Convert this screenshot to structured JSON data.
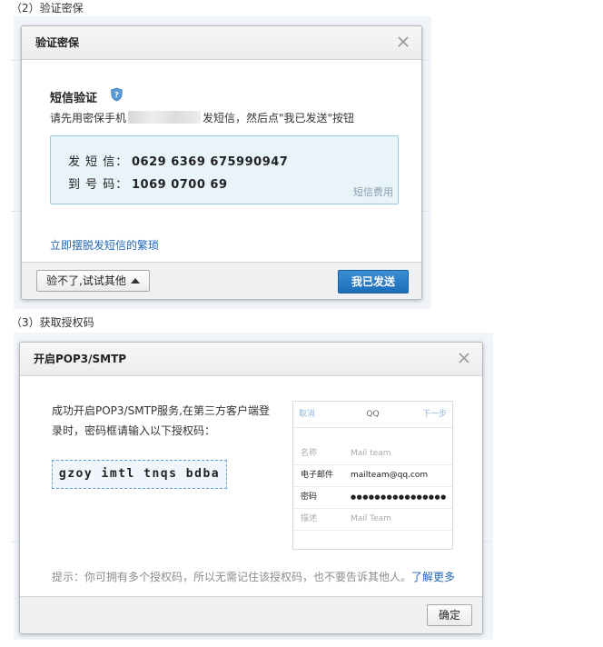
{
  "sections": {
    "step2_label": "（2）验证密保",
    "step3_label": "（3）获取授权码"
  },
  "dialog_verify": {
    "title": "验证密保",
    "heading": "短信验证",
    "instruction_prefix": "请先用密保手机",
    "instruction_suffix": "发短信，然后点\"我已发送\"按钮",
    "send_sms_label": "发 短 信：",
    "send_sms_value": "0629 6369 675990947",
    "to_number_label": "到 号 码：",
    "to_number_value": "1069 0700 69",
    "fee_link": "短信费用",
    "escape_link": "立即摆脱发短信的繁琐",
    "alt_button": "验不了,试试其他",
    "send_button": "我已发送"
  },
  "dialog_auth": {
    "title": "开启POP3/SMTP",
    "description": "成功开启POP3/SMTP服务,在第三方客户端登录时，密码框请输入以下授权码：",
    "auth_code": "gzoy imtl tnqs bdba",
    "phone": {
      "cancel": "取消",
      "title": "QQ",
      "next": "下一步",
      "rows": [
        {
          "label": "名称",
          "value": "Mail team",
          "muted": true
        },
        {
          "label": "电子邮件",
          "value": "mailteam@qq.com",
          "muted": false
        },
        {
          "label": "密码",
          "value": "●●●●●●●●●●●●●●●●",
          "muted": false
        },
        {
          "label": "描述",
          "value": "Mail Team",
          "muted": true
        }
      ]
    },
    "tip": "提示：你可拥有多个授权码，所以无需记住该授权码，也不要告诉其他人。",
    "learn_more": "了解更多",
    "ok_button": "确定"
  },
  "colors": {
    "accent_blue": "#2168b8",
    "primary_button": "#1d6db8",
    "info_box_bg": "#e8f3fa"
  }
}
